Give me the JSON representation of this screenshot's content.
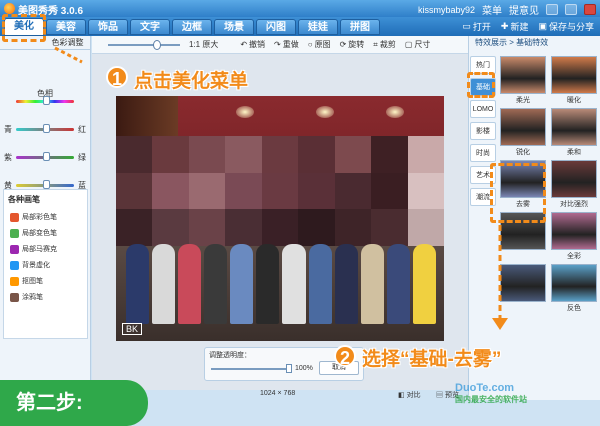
{
  "app": {
    "title": "美图秀秀 3.0.6",
    "user": "kissmybaby92",
    "menu_label": "菜单",
    "feedback_label": "提意见"
  },
  "tabs": [
    "美化",
    "美容",
    "饰品",
    "文字",
    "边框",
    "场景",
    "闪图",
    "娃娃",
    "拼图"
  ],
  "toolbar_right": {
    "open": "打开",
    "new": "新建",
    "save_share": "保存与分享"
  },
  "left_panel": {
    "subtab_active": "",
    "subtab_other": "色彩调整",
    "sliders": [
      {
        "center": "色相",
        "left": "",
        "right": "",
        "level": 0.5,
        "gradient": "linear-gradient(90deg,#e33,#ee3,#3e3,#3ee,#33e,#e3e,#e33)"
      },
      {
        "center": "",
        "left": "青",
        "right": "红",
        "level": 0.5,
        "gradient": "linear-gradient(90deg,#3cc,#c33)"
      },
      {
        "center": "",
        "left": "紫",
        "right": "绿",
        "level": 0.5,
        "gradient": "linear-gradient(90deg,#a3c,#3a3)"
      },
      {
        "center": "",
        "left": "黄",
        "right": "蓝",
        "level": 0.5,
        "gradient": "linear-gradient(90deg,#dc3,#36c)"
      }
    ],
    "brush_title": "各种画笔",
    "brushes": [
      {
        "label": "局部彩色笔",
        "color": "#e4572e"
      },
      {
        "label": "局部变色笔",
        "color": "#4caf50"
      },
      {
        "label": "局部马赛克",
        "color": "#9c27b0"
      },
      {
        "label": "背景虚化",
        "color": "#2196f3"
      },
      {
        "label": "抠图笔",
        "color": "#ff9800"
      },
      {
        "label": "涂鸦笔",
        "color": "#795548"
      }
    ]
  },
  "center_toolbar": {
    "zoom_level": 0.7,
    "original_size": "1:1 原大",
    "undo": "撤销",
    "redo": "重做",
    "original": "原图",
    "rotate": "旋转",
    "crop": "裁剪",
    "resize": "尺寸"
  },
  "opacity": {
    "label": "调整透明度：",
    "value": "100%",
    "level": 1.0,
    "cancel": "取消"
  },
  "status": {
    "dimensions": "1024 × 768",
    "compare": "对比",
    "preview": "预览"
  },
  "right_panel": {
    "header": "特效展示 > 基础特效",
    "categories": [
      "热门",
      "基础",
      "LOMO",
      "影楼",
      "时尚",
      "艺术",
      "潮流"
    ],
    "active_category": 1,
    "effects": [
      {
        "name": "柔光",
        "tone": "#c98a6a"
      },
      {
        "name": "暖化",
        "tone": "#d07a4a"
      },
      {
        "name": "锐化",
        "tone": "#a06a55"
      },
      {
        "name": "柔和",
        "tone": "#b88a78"
      },
      {
        "name": "去雾",
        "tone": "#7a86b4"
      },
      {
        "name": "对比强烈",
        "tone": "#6a3a3a"
      },
      {
        "name": "",
        "tone": "#555555"
      },
      {
        "name": "全彩",
        "tone": "#b06a90"
      },
      {
        "name": "",
        "tone": "#4a5a7a"
      },
      {
        "name": "反色",
        "tone": "#5aa0c8"
      }
    ]
  },
  "photo": {
    "mark": "BK"
  },
  "annotations": {
    "step1_num": "1",
    "step1_text": "点击美化菜单",
    "step2_num": "2",
    "step2_text": "选择“基础-去雾”",
    "step_badge": "第二步:",
    "watermark_top": "DuoTe.com",
    "watermark_bottom": "国内最安全的软件站",
    "accent": "#f28b1a",
    "badge_color": "#2fa84a"
  }
}
